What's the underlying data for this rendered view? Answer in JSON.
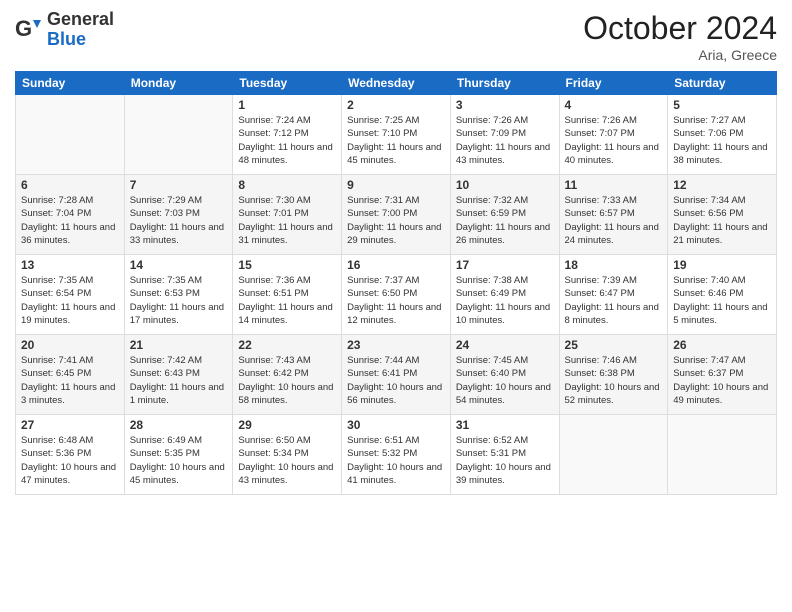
{
  "logo": {
    "general": "General",
    "blue": "Blue"
  },
  "header": {
    "month": "October 2024",
    "location": "Aria, Greece"
  },
  "weekdays": [
    "Sunday",
    "Monday",
    "Tuesday",
    "Wednesday",
    "Thursday",
    "Friday",
    "Saturday"
  ],
  "weeks": [
    [
      {
        "day": null
      },
      {
        "day": null
      },
      {
        "day": "1",
        "sunrise": "7:24 AM",
        "sunset": "7:12 PM",
        "daylight": "11 hours and 48 minutes."
      },
      {
        "day": "2",
        "sunrise": "7:25 AM",
        "sunset": "7:10 PM",
        "daylight": "11 hours and 45 minutes."
      },
      {
        "day": "3",
        "sunrise": "7:26 AM",
        "sunset": "7:09 PM",
        "daylight": "11 hours and 43 minutes."
      },
      {
        "day": "4",
        "sunrise": "7:26 AM",
        "sunset": "7:07 PM",
        "daylight": "11 hours and 40 minutes."
      },
      {
        "day": "5",
        "sunrise": "7:27 AM",
        "sunset": "7:06 PM",
        "daylight": "11 hours and 38 minutes."
      }
    ],
    [
      {
        "day": "6",
        "sunrise": "7:28 AM",
        "sunset": "7:04 PM",
        "daylight": "11 hours and 36 minutes."
      },
      {
        "day": "7",
        "sunrise": "7:29 AM",
        "sunset": "7:03 PM",
        "daylight": "11 hours and 33 minutes."
      },
      {
        "day": "8",
        "sunrise": "7:30 AM",
        "sunset": "7:01 PM",
        "daylight": "11 hours and 31 minutes."
      },
      {
        "day": "9",
        "sunrise": "7:31 AM",
        "sunset": "7:00 PM",
        "daylight": "11 hours and 29 minutes."
      },
      {
        "day": "10",
        "sunrise": "7:32 AM",
        "sunset": "6:59 PM",
        "daylight": "11 hours and 26 minutes."
      },
      {
        "day": "11",
        "sunrise": "7:33 AM",
        "sunset": "6:57 PM",
        "daylight": "11 hours and 24 minutes."
      },
      {
        "day": "12",
        "sunrise": "7:34 AM",
        "sunset": "6:56 PM",
        "daylight": "11 hours and 21 minutes."
      }
    ],
    [
      {
        "day": "13",
        "sunrise": "7:35 AM",
        "sunset": "6:54 PM",
        "daylight": "11 hours and 19 minutes."
      },
      {
        "day": "14",
        "sunrise": "7:35 AM",
        "sunset": "6:53 PM",
        "daylight": "11 hours and 17 minutes."
      },
      {
        "day": "15",
        "sunrise": "7:36 AM",
        "sunset": "6:51 PM",
        "daylight": "11 hours and 14 minutes."
      },
      {
        "day": "16",
        "sunrise": "7:37 AM",
        "sunset": "6:50 PM",
        "daylight": "11 hours and 12 minutes."
      },
      {
        "day": "17",
        "sunrise": "7:38 AM",
        "sunset": "6:49 PM",
        "daylight": "11 hours and 10 minutes."
      },
      {
        "day": "18",
        "sunrise": "7:39 AM",
        "sunset": "6:47 PM",
        "daylight": "11 hours and 8 minutes."
      },
      {
        "day": "19",
        "sunrise": "7:40 AM",
        "sunset": "6:46 PM",
        "daylight": "11 hours and 5 minutes."
      }
    ],
    [
      {
        "day": "20",
        "sunrise": "7:41 AM",
        "sunset": "6:45 PM",
        "daylight": "11 hours and 3 minutes."
      },
      {
        "day": "21",
        "sunrise": "7:42 AM",
        "sunset": "6:43 PM",
        "daylight": "11 hours and 1 minute."
      },
      {
        "day": "22",
        "sunrise": "7:43 AM",
        "sunset": "6:42 PM",
        "daylight": "10 hours and 58 minutes."
      },
      {
        "day": "23",
        "sunrise": "7:44 AM",
        "sunset": "6:41 PM",
        "daylight": "10 hours and 56 minutes."
      },
      {
        "day": "24",
        "sunrise": "7:45 AM",
        "sunset": "6:40 PM",
        "daylight": "10 hours and 54 minutes."
      },
      {
        "day": "25",
        "sunrise": "7:46 AM",
        "sunset": "6:38 PM",
        "daylight": "10 hours and 52 minutes."
      },
      {
        "day": "26",
        "sunrise": "7:47 AM",
        "sunset": "6:37 PM",
        "daylight": "10 hours and 49 minutes."
      }
    ],
    [
      {
        "day": "27",
        "sunrise": "6:48 AM",
        "sunset": "5:36 PM",
        "daylight": "10 hours and 47 minutes."
      },
      {
        "day": "28",
        "sunrise": "6:49 AM",
        "sunset": "5:35 PM",
        "daylight": "10 hours and 45 minutes."
      },
      {
        "day": "29",
        "sunrise": "6:50 AM",
        "sunset": "5:34 PM",
        "daylight": "10 hours and 43 minutes."
      },
      {
        "day": "30",
        "sunrise": "6:51 AM",
        "sunset": "5:32 PM",
        "daylight": "10 hours and 41 minutes."
      },
      {
        "day": "31",
        "sunrise": "6:52 AM",
        "sunset": "5:31 PM",
        "daylight": "10 hours and 39 minutes."
      },
      {
        "day": null
      },
      {
        "day": null
      }
    ]
  ]
}
